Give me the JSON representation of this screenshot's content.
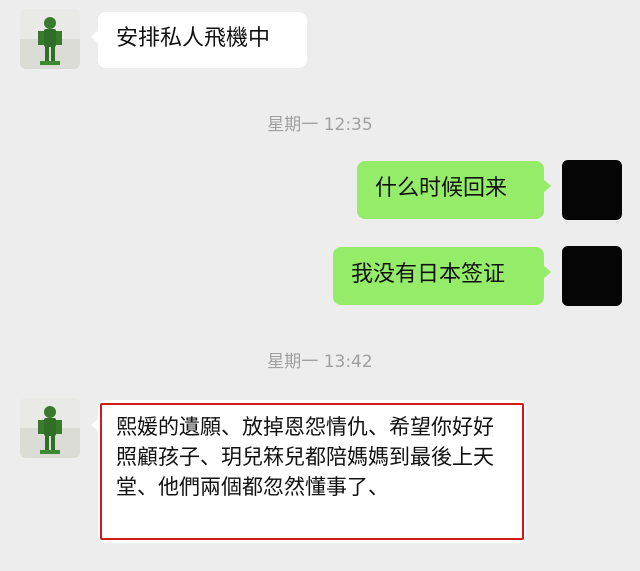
{
  "messages": [
    {
      "from": "left",
      "text": "安排私人飛機中"
    },
    {
      "from": "right",
      "text": "什么时候回来"
    },
    {
      "from": "right",
      "text": "我没有日本签证"
    },
    {
      "from": "left",
      "text": "熙媛的遺願、放掉恩怨情仇、希望你好好照顧孩子、玥兒箖兒都陪媽媽到最後上天堂、他們兩個都忽然懂事了、"
    }
  ],
  "timestamps": [
    "星期一 12:35",
    "星期一 13:42"
  ],
  "colors": {
    "bg": "#ededed",
    "incoming": "#ffffff",
    "outgoing": "#95ec69",
    "highlight": "#d21a1a"
  }
}
